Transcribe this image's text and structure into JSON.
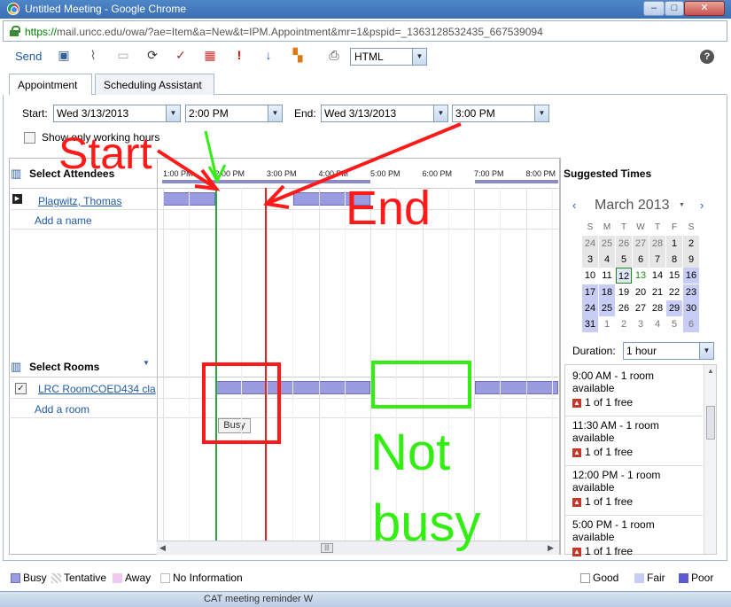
{
  "window": {
    "title": "Untitled Meeting - Google Chrome"
  },
  "address": {
    "scheme": "https://",
    "rest": "mail.uncc.edu/owa/?ae=Item&a=New&t=IPM.Appointment&mr=1&pspid=_1363128532435_667539094"
  },
  "toolbar": {
    "send_label": "Send",
    "format_value": "HTML",
    "help_label": "?"
  },
  "tabs": [
    {
      "label": "Appointment"
    },
    {
      "label": "Scheduling Assistant"
    }
  ],
  "times": {
    "start_label": "Start:",
    "start_date": "Wed 3/13/2013",
    "start_time": "2:00 PM",
    "end_label": "End:",
    "end_date": "Wed 3/13/2013",
    "end_time": "3:00 PM",
    "working_hours_label": "Show only working hours"
  },
  "timeline": {
    "hours": [
      "1:00 PM",
      "2:00 PM",
      "3:00 PM",
      "4:00 PM",
      "5:00 PM",
      "6:00 PM",
      "7:00 PM",
      "8:00 PM"
    ]
  },
  "attendees": {
    "title": "Select Attendees",
    "items": [
      {
        "name": "Plagwitz, Thomas"
      }
    ],
    "add_label": "Add a name"
  },
  "rooms": {
    "title": "Select Rooms",
    "items": [
      {
        "name": "LRC RoomCOED434 cla"
      }
    ],
    "add_label": "Add a room",
    "busy_tooltip": "Busy"
  },
  "suggested": {
    "title": "Suggested Times",
    "month": "March 2013",
    "weekdays": [
      "S",
      "M",
      "T",
      "W",
      "T",
      "F",
      "S"
    ],
    "weeks": [
      [
        "24",
        "25",
        "26",
        "27",
        "28",
        "1",
        "2"
      ],
      [
        "3",
        "4",
        "5",
        "6",
        "7",
        "8",
        "9"
      ],
      [
        "10",
        "11",
        "12",
        "13",
        "14",
        "15",
        "16"
      ],
      [
        "17",
        "18",
        "19",
        "20",
        "21",
        "22",
        "23"
      ],
      [
        "24",
        "25",
        "26",
        "27",
        "28",
        "29",
        "30"
      ],
      [
        "31",
        "1",
        "2",
        "3",
        "4",
        "5",
        "6"
      ]
    ],
    "duration_label": "Duration:",
    "duration_value": "1 hour",
    "slots": [
      {
        "time": "9:00 AM - 1 room",
        "status": "available",
        "free": "1 of 1 free"
      },
      {
        "time": "11:30 AM - 1 room",
        "status": "available",
        "free": "1 of 1 free"
      },
      {
        "time": "12:00 PM - 1 room",
        "status": "available",
        "free": "1 of 1 free"
      },
      {
        "time": "5:00 PM - 1 room",
        "status": "available",
        "free": "1 of 1 free"
      }
    ]
  },
  "legend": {
    "busy": "Busy",
    "tentative": "Tentative",
    "away": "Away",
    "noinfo": "No Information",
    "good": "Good",
    "fair": "Fair",
    "poor": "Poor"
  },
  "annotations": {
    "start": "Start",
    "end": "End",
    "not": "Not",
    "busy": "busy"
  },
  "taskbar": {
    "text": "CAT meeting reminder W"
  },
  "colors": {
    "busy": "#9b9be0",
    "annotation_red": "#ff1a1a",
    "annotation_green": "#33ee11",
    "start_line": "#27a844",
    "end_line": "#d62a2a"
  }
}
